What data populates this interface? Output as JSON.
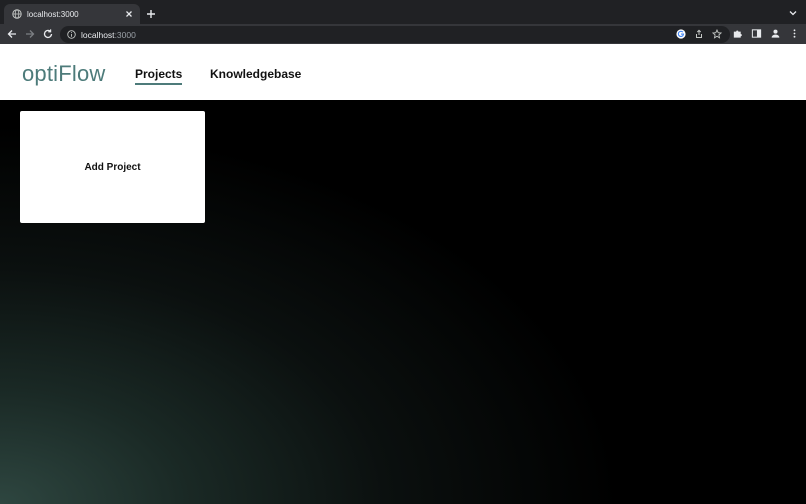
{
  "browser": {
    "tab": {
      "title": "localhost:3000"
    },
    "address": {
      "host": "localhost",
      "port": ":3000"
    }
  },
  "app": {
    "logo": "optiFlow",
    "nav": [
      {
        "label": "Projects",
        "active": true
      },
      {
        "label": "Knowledgebase",
        "active": false
      }
    ],
    "add_project": "Add Project"
  },
  "colors": {
    "accent": "#4d7b7a",
    "chrome_dark": "#202124",
    "chrome_toolbar": "#35363a"
  },
  "icons": [
    "globe-icon",
    "close-icon",
    "plus-icon",
    "chevron-down-icon",
    "back-arrow-icon",
    "forward-arrow-icon",
    "reload-icon",
    "info-icon",
    "google-icon",
    "share-icon",
    "star-icon",
    "puzzle-icon",
    "side-panel-icon",
    "profile-icon",
    "kebab-menu-icon"
  ]
}
